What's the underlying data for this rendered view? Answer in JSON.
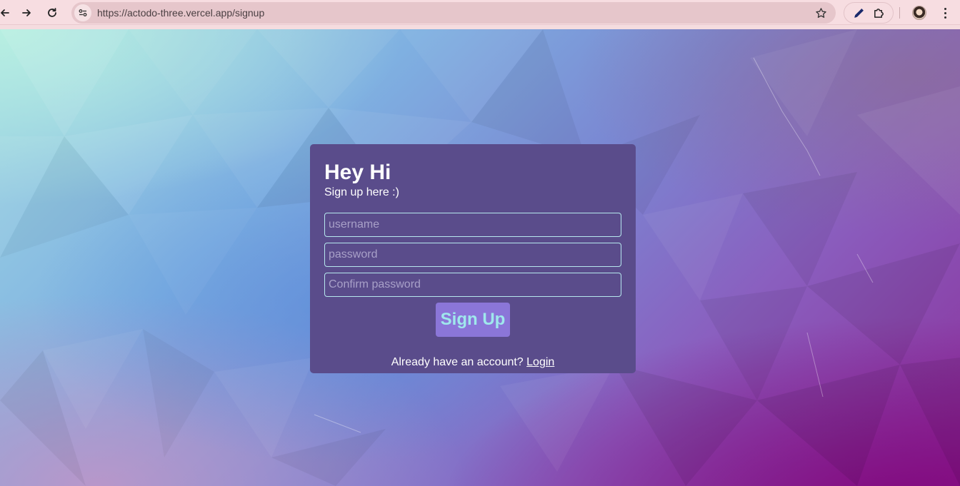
{
  "browser": {
    "url": "https://actodo-three.vercel.app/signup",
    "icons": {
      "back": "back-arrow-icon",
      "forward": "forward-arrow-icon",
      "reload": "reload-icon",
      "site_info": "site-info-icon",
      "bookmark": "star-icon",
      "extension_1": "eyedropper-icon",
      "extension_2": "puzzle-icon",
      "profile": "avatar",
      "menu": "kebab-menu-icon"
    }
  },
  "signup": {
    "title": "Hey Hi",
    "subtitle": "Sign up here :)",
    "username_placeholder": "username",
    "password_placeholder": "password",
    "confirm_placeholder": "Confirm password",
    "submit_label": "Sign Up",
    "login_prompt": "Already have an account?",
    "login_link": "Login"
  },
  "colors": {
    "card_background": "#5a4c8b",
    "button_background": "#8b76d8",
    "button_text": "#9fe8ec",
    "input_border": "#b6e8ee",
    "chrome_background": "#f7dde1"
  }
}
